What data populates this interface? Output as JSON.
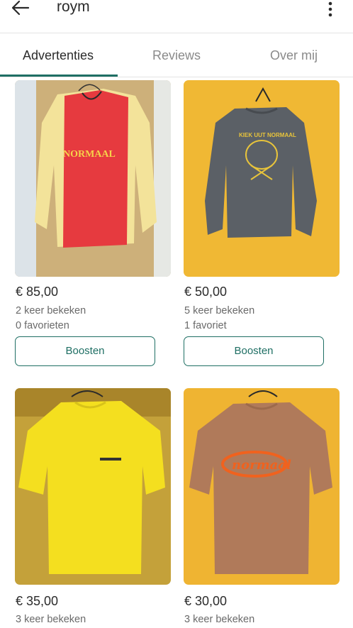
{
  "header": {
    "title": "roym",
    "back_icon": "arrow-left-icon",
    "menu_icon": "more-vertical-icon"
  },
  "tabs": [
    {
      "label": "Advertenties",
      "active": true
    },
    {
      "label": "Reviews",
      "active": false
    },
    {
      "label": "Over mij",
      "active": false
    }
  ],
  "colors": {
    "accent": "#1f6f64"
  },
  "listings": [
    {
      "image": "red-yellow-normaal-long-sleeve-shirt",
      "price": "€ 85,00",
      "views": "2 keer bekeken",
      "favorites": "0 favorieten",
      "button": "Boosten",
      "print_text": "NORMAAL"
    },
    {
      "image": "grey-sweater-kiek-uut-normaal",
      "price": "€ 50,00",
      "views": "5 keer bekeken",
      "favorites": "1 favoriet",
      "button": "Boosten",
      "print_text": "KIEK UUT NORMAAL"
    },
    {
      "image": "yellow-t-shirt",
      "price": "€ 35,00",
      "views": "3 keer bekeken"
    },
    {
      "image": "brown-t-shirt-orange-logo",
      "price": "€ 30,00",
      "views": "3 keer bekeken",
      "print_text": "normaal"
    }
  ]
}
